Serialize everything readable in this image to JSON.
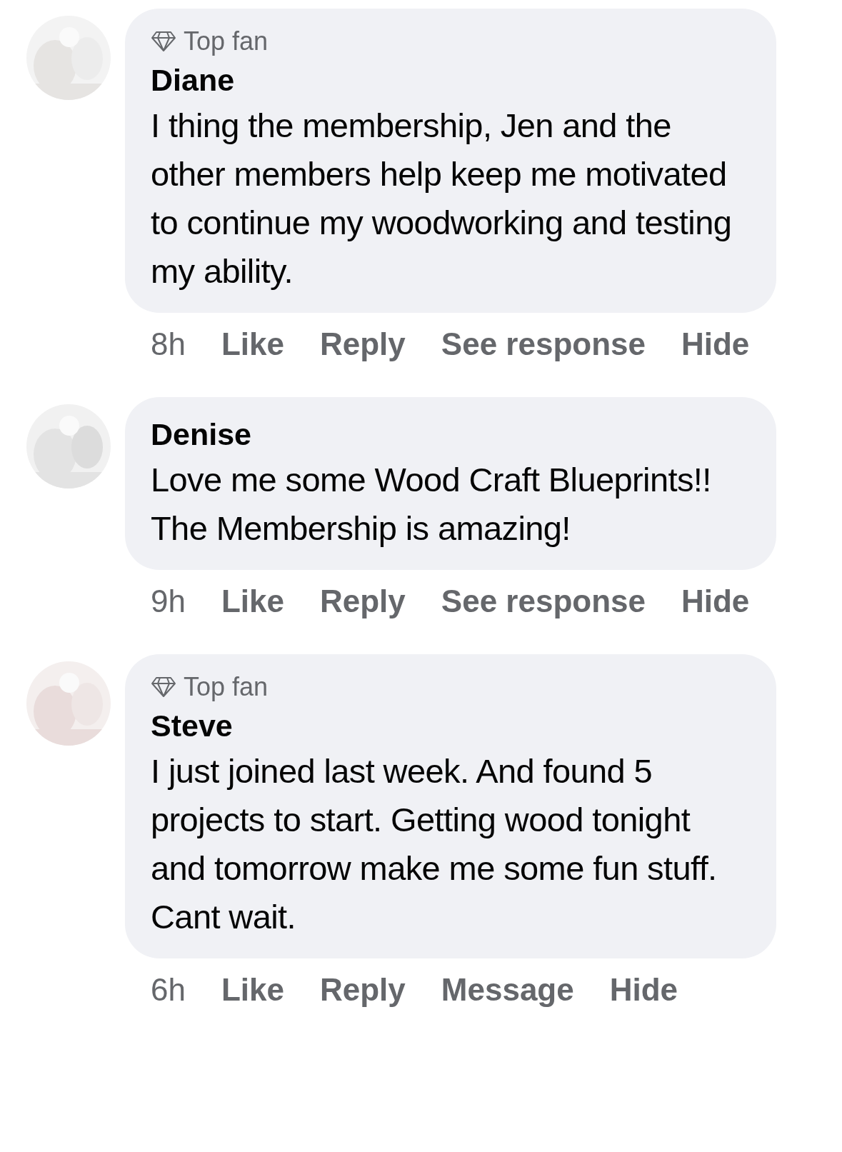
{
  "comments": [
    {
      "badge": "Top fan",
      "author": "Diane",
      "text": "I thing the membership, Jen and the other members help keep me motivated to continue my woodworking and testing my ability.",
      "time": "8h",
      "actions": [
        "Like",
        "Reply",
        "See response",
        "Hide"
      ]
    },
    {
      "author": "Denise",
      "text": "Love me some Wood Craft Blueprints!! The Membership is amazing!",
      "time": "9h",
      "actions": [
        "Like",
        "Reply",
        "See response",
        "Hide"
      ]
    },
    {
      "badge": "Top fan",
      "author": "Steve",
      "text": "I just joined last week. And found 5 projects to start. Getting wood tonight and tomorrow make me some fun stuff.  Cant wait.",
      "time": "6h",
      "actions": [
        "Like",
        "Reply",
        "Message",
        "Hide"
      ]
    }
  ]
}
